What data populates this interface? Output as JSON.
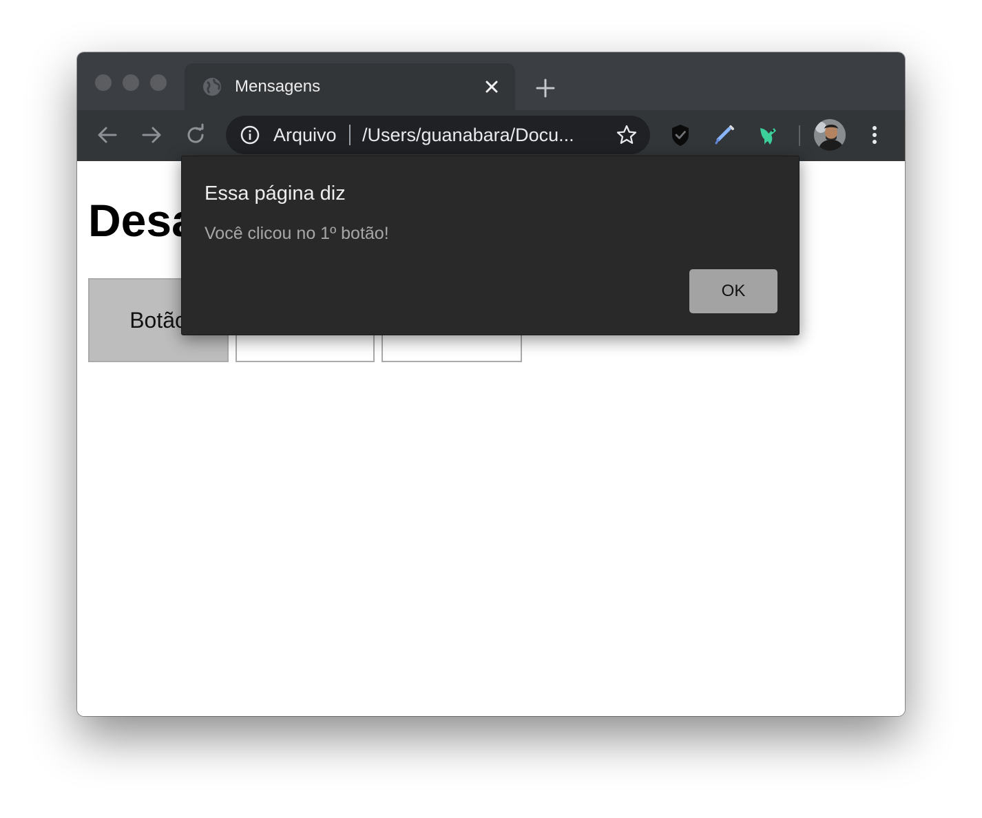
{
  "browser": {
    "tab": {
      "title": "Mensagens"
    },
    "omnibox": {
      "scheme_label": "Arquivo",
      "url": "/Users/guanabara/Docu..."
    },
    "icons": {
      "back": "arrow-left-icon",
      "forward": "arrow-right-icon",
      "reload": "reload-icon",
      "info": "info-icon",
      "bookmark": "star-icon",
      "extension_1": "shield-check-icon",
      "extension_2": "eyedropper-icon",
      "extension_3": "bird-icon",
      "menu": "vertical-dots-icon"
    },
    "colors": {
      "tabstrip": "#3b3e42",
      "toolbar": "#323639",
      "omnibox": "#202124"
    }
  },
  "page": {
    "heading": "Desa",
    "buttons": [
      {
        "label": "Botão",
        "state": "active"
      },
      {
        "label": ""
      },
      {
        "label": ""
      }
    ]
  },
  "dialog": {
    "title": "Essa página diz",
    "message": "Você clicou no 1º botão!",
    "ok_label": "OK",
    "colors": {
      "background": "#292929",
      "button": "#a3a3a3"
    }
  }
}
